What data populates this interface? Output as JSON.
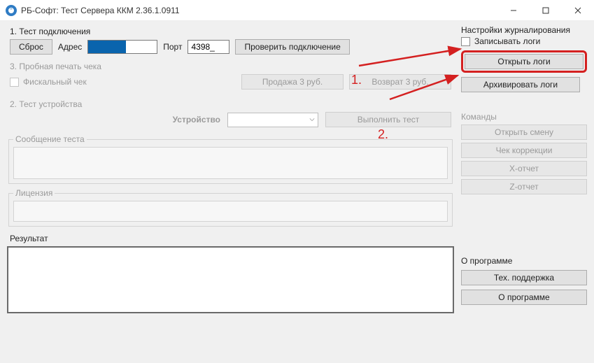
{
  "window": {
    "title": "РБ-Софт: Тест Сервера ККМ 2.36.1.0911"
  },
  "test_connection": {
    "title": "1. Тест подключения",
    "reset_btn": "Сброс",
    "address_label": "Адрес",
    "port_label": "Порт",
    "port_value": "4398_",
    "check_btn": "Проверить подключение"
  },
  "trial_print": {
    "title": "3. Пробная печать чека",
    "fiscal_checkbox": "Фискальный чек",
    "sale_btn": "Продажа 3 руб.",
    "return_btn": "Возврат 3 руб."
  },
  "device_test": {
    "title": "2. Тест устройства",
    "device_label": "Устройство",
    "run_btn": "Выполнить тест",
    "msg_label": "Сообщение теста",
    "license_label": "Лицензия"
  },
  "result": {
    "title": "Результат"
  },
  "logging": {
    "title": "Настройки журналирования",
    "write_label": "Записывать логи",
    "open_btn": "Открыть логи",
    "archive_btn": "Архивировать логи"
  },
  "commands": {
    "title": "Команды",
    "open_shift": "Открыть смену",
    "correction": "Чек коррекции",
    "x_report": "X-отчет",
    "z_report": "Z-отчет"
  },
  "about": {
    "title": "О программе",
    "support_btn": "Тех. поддержка",
    "about_btn": "О программе"
  },
  "annotations": {
    "one": "1.",
    "two": "2."
  }
}
